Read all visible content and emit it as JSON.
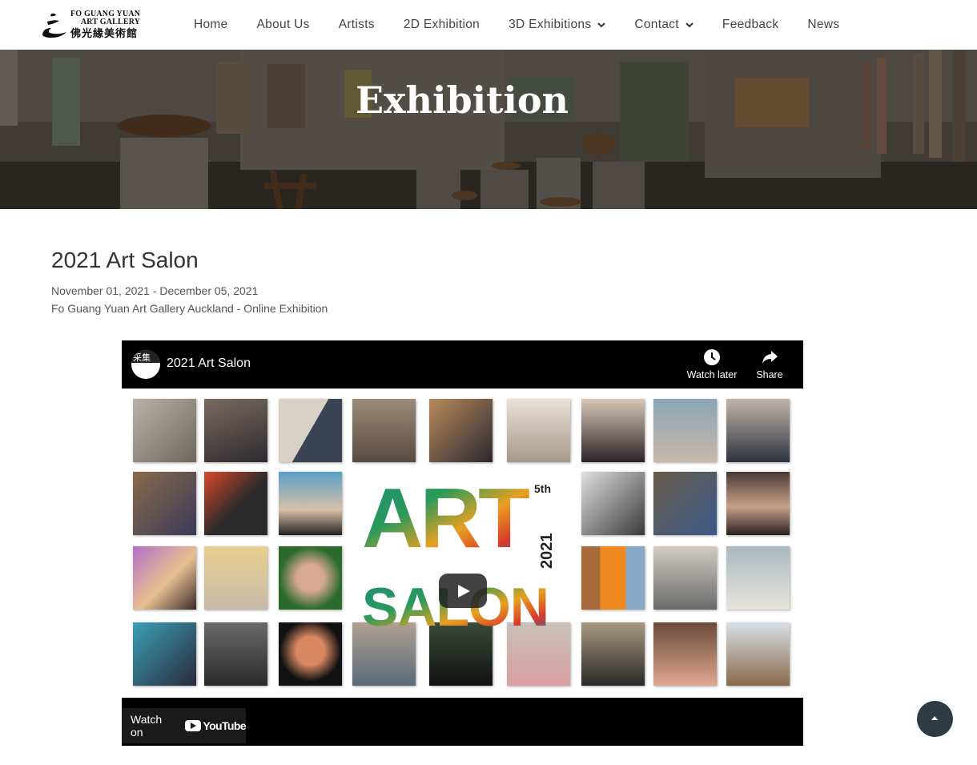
{
  "site": {
    "logo_en_line1": "FO GUANG YUAN",
    "logo_en_line2": "ART GALLERY",
    "logo_zh": "佛光緣美術館"
  },
  "nav": {
    "items": [
      {
        "label": "Home",
        "dropdown": false
      },
      {
        "label": "About Us",
        "dropdown": false
      },
      {
        "label": "Artists",
        "dropdown": false
      },
      {
        "label": "2D Exhibition",
        "dropdown": false
      },
      {
        "label": "3D Exhibitions",
        "dropdown": true
      },
      {
        "label": "Contact",
        "dropdown": true
      },
      {
        "label": "Feedback",
        "dropdown": false
      },
      {
        "label": "News",
        "dropdown": false
      }
    ]
  },
  "hero": {
    "title": "Exhibition"
  },
  "exhibition": {
    "title": "2021 Art Salon",
    "dates": "November 01, 2021 - December 05, 2021",
    "location": "Fo Guang Yuan Art Gallery Auckland - Online Exhibition"
  },
  "video": {
    "channel_badge": "采集",
    "title": "2021 Art Salon",
    "watch_later": "Watch later",
    "share": "Share",
    "watch_on": "Watch on",
    "youtube": "YouTube",
    "thumb_word1": "ART",
    "thumb_word2": "SALON",
    "thumb_year": "2021",
    "thumb_edition": "5th"
  },
  "colors": {
    "nav_text": "#444444",
    "dark_overlay": "#4a423a",
    "to_top_bg": "#2f3a45"
  },
  "icons": [
    "chevron-down-icon",
    "clock-icon",
    "share-arrow-icon",
    "play-icon",
    "youtube-icon",
    "arrow-up-icon"
  ]
}
